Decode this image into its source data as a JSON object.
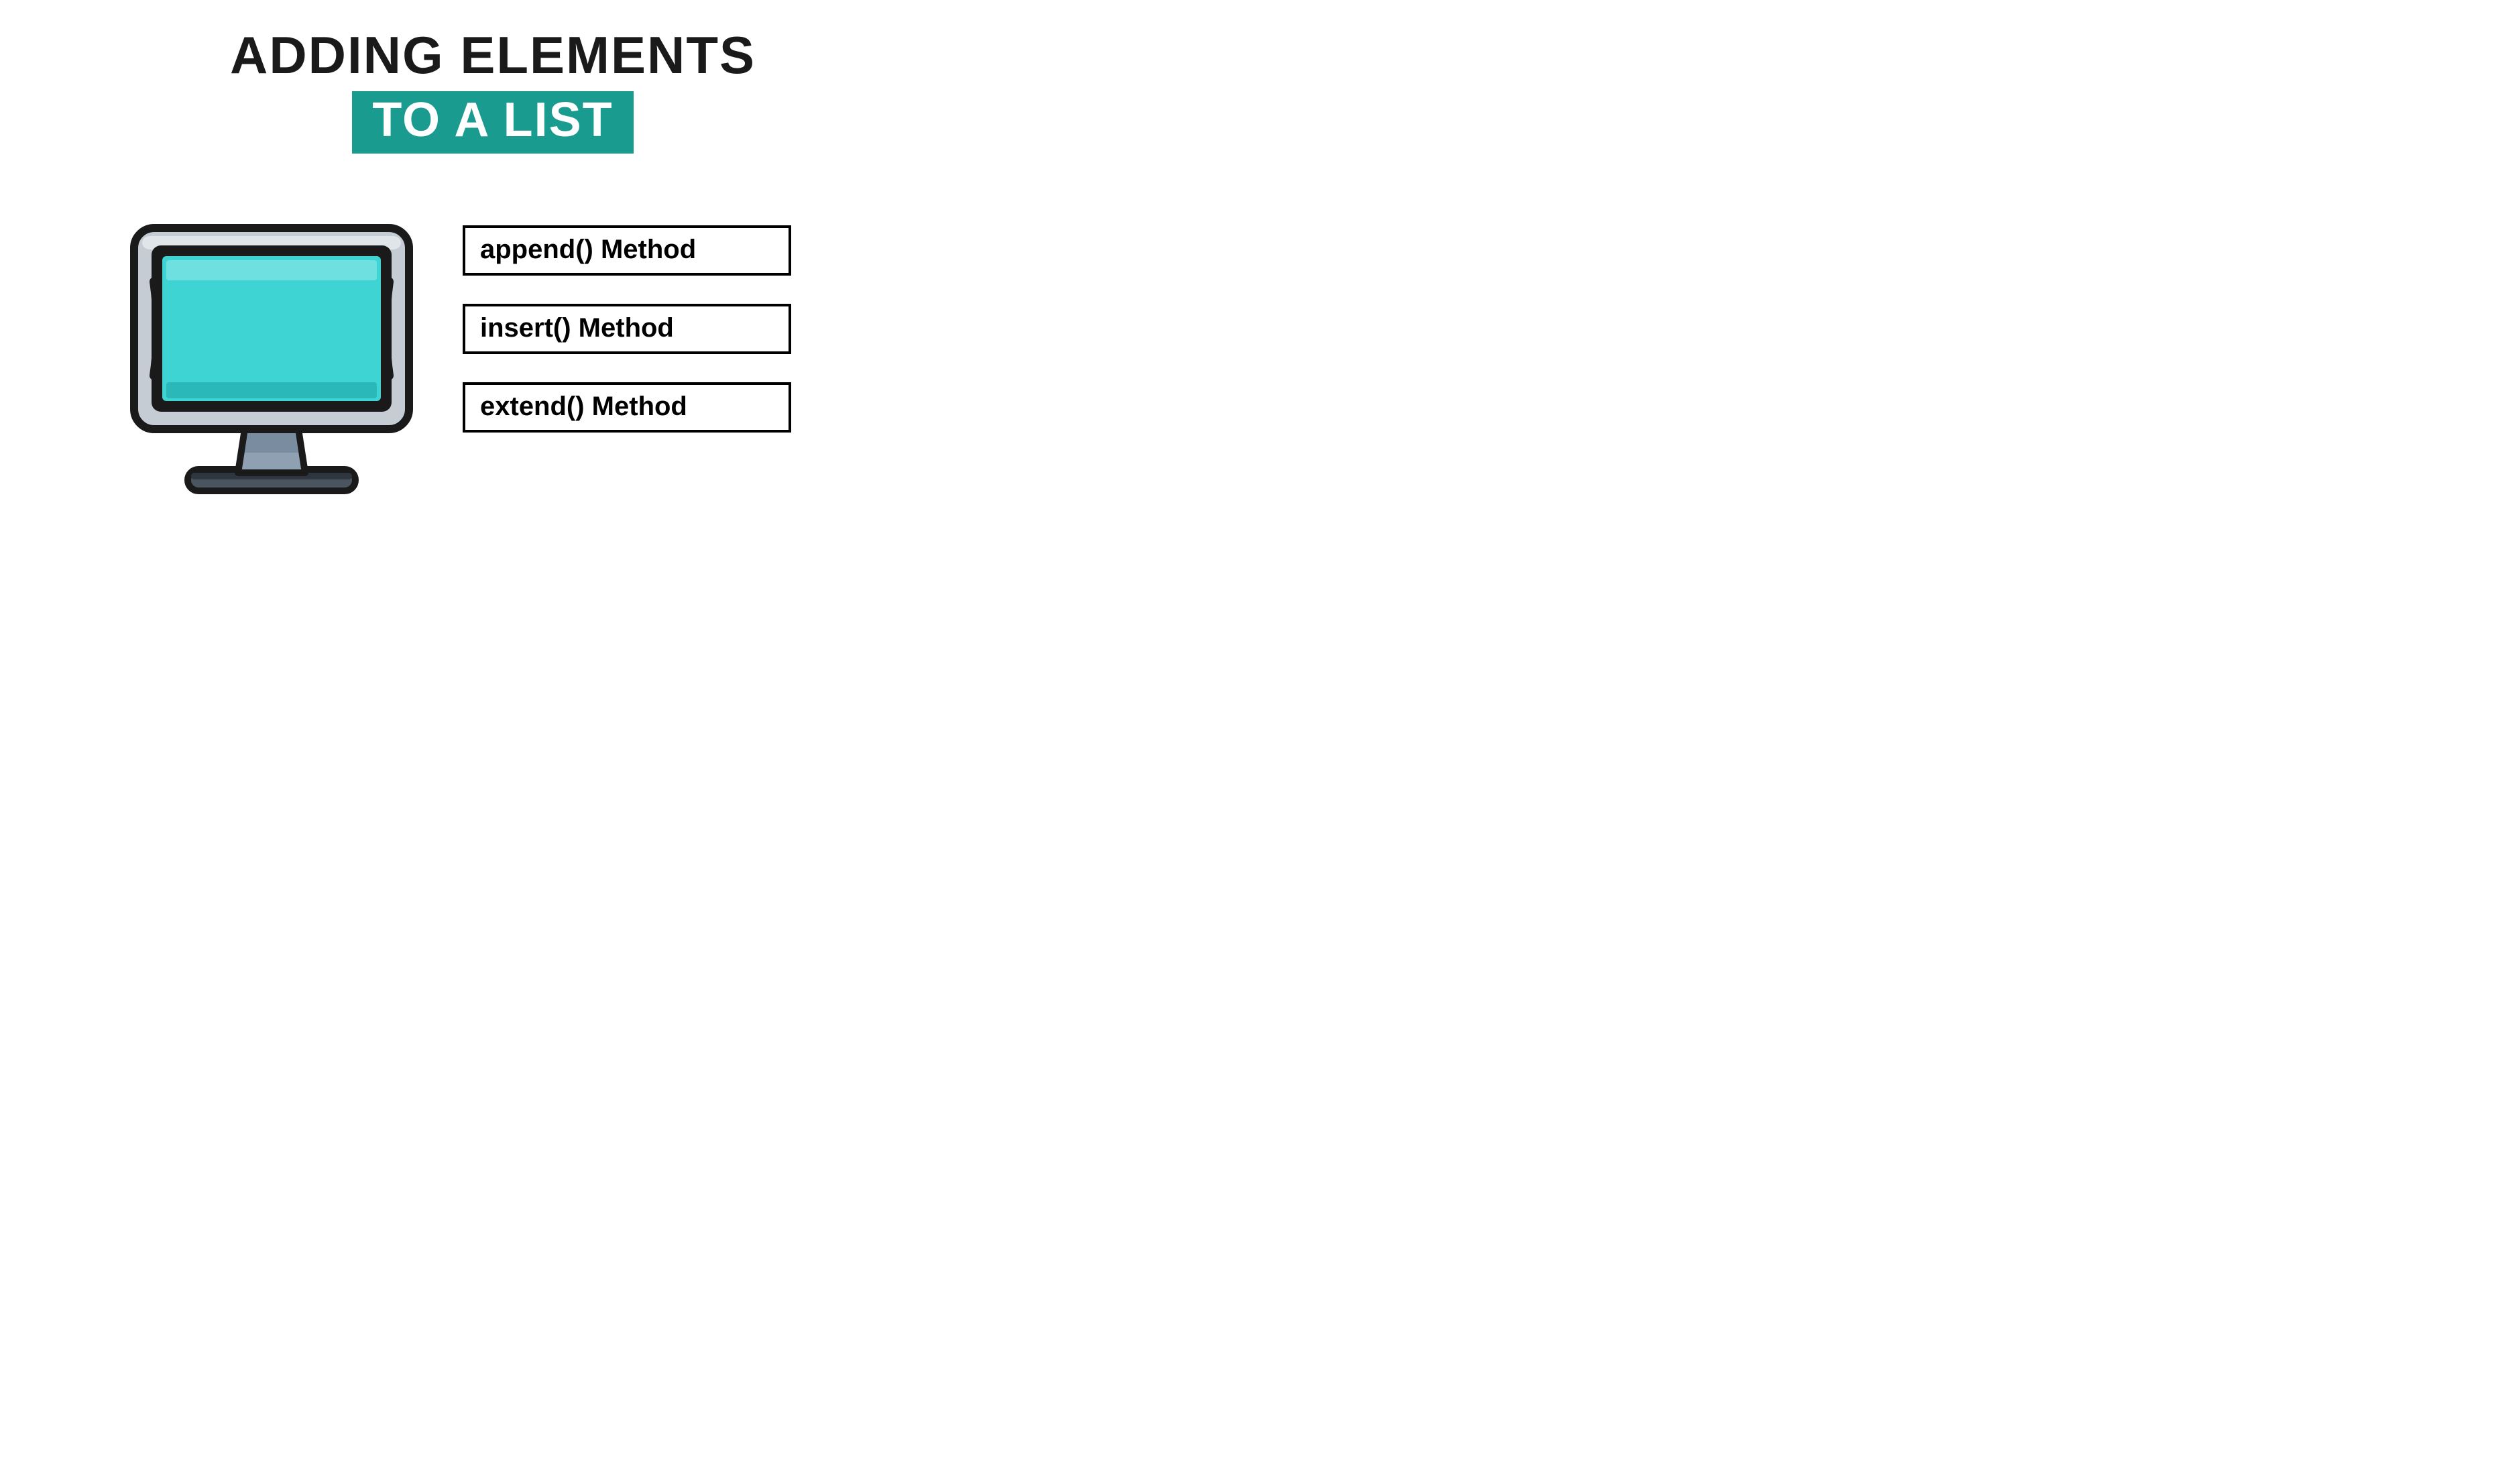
{
  "title": {
    "line1": "ADDING ELEMENTS",
    "line2": "TO A LIST"
  },
  "methods": [
    {
      "label": "append() Method"
    },
    {
      "label": "insert() Method"
    },
    {
      "label": "extend() Method"
    }
  ],
  "colors": {
    "accent": "#1a9b8f",
    "screen": "#3fd4d4",
    "text": "#1a1a1a"
  }
}
